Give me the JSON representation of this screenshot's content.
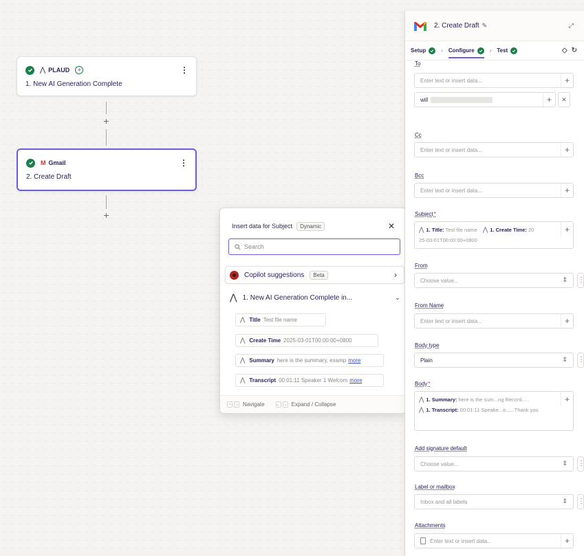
{
  "canvas": {
    "step1": {
      "app": "PLAUD",
      "title": "1. New AI Generation Complete"
    },
    "step2": {
      "app": "Gmail",
      "title": "2. Create Draft"
    }
  },
  "popup": {
    "title": "Insert data for Subject",
    "tag": "Dynamic",
    "search_placeholder": "Search",
    "copilot_label": "Copilot suggestions",
    "copilot_tag": "Beta",
    "group_title": "1.  New AI Generation Complete in...",
    "items": [
      {
        "key": "Title",
        "value": "Test file name",
        "more": ""
      },
      {
        "key": "Create Time",
        "value": "2025-03-01T00:00:00+0800",
        "more": ""
      },
      {
        "key": "Summary",
        "value": "here is the summary, examp",
        "more": "more"
      },
      {
        "key": "Transcript",
        "value": "00:01:11 Speaker 1 Welcom",
        "more": "more"
      }
    ],
    "footer": {
      "navigate": "Navigate",
      "expand": "Expand / Collapse"
    }
  },
  "panel": {
    "title": "2. Create Draft",
    "tabs": {
      "setup": "Setup",
      "configure": "Configure",
      "test": "Test"
    },
    "fields": {
      "to": {
        "label": "To",
        "placeholder": "Enter text or insert data...",
        "value": "will"
      },
      "cc": {
        "label": "Cc",
        "placeholder": "Enter text or insert data..."
      },
      "bcc": {
        "label": "Bcc",
        "placeholder": "Enter text or insert data..."
      },
      "subject": {
        "label": "Subject",
        "chip1_key": "1. Title:",
        "chip1_val": "Test file name",
        "chip2_key": "1. Create Time:",
        "chip2_val": "20",
        "cont": "25-03-01T00:00:00+0800"
      },
      "from": {
        "label": "From",
        "placeholder": "Choose value..."
      },
      "from_name": {
        "label": "From Name",
        "placeholder": "Enter text or insert data..."
      },
      "body_type": {
        "label": "Body type",
        "value": "Plain"
      },
      "body": {
        "label": "Body",
        "chip1_key": "1. Summary:",
        "chip1_val": "here is the sum...ng Record.....",
        "chip2_key": "1. Transcript:",
        "chip2_val": "00:01:11 Speake...o......Thank you"
      },
      "signature": {
        "label": "Add signature default",
        "placeholder": "Choose value..."
      },
      "label_mailbox": {
        "label": "Label or mailbox",
        "value": "Inbox and all labels"
      },
      "attachments": {
        "label": "Attachments",
        "placeholder": "Enter text or insert data..."
      }
    }
  },
  "colors": {
    "accent": "#6a5de0",
    "success": "#1a7f4b",
    "gmail_red": "#d93025",
    "text": "#2b2358"
  }
}
